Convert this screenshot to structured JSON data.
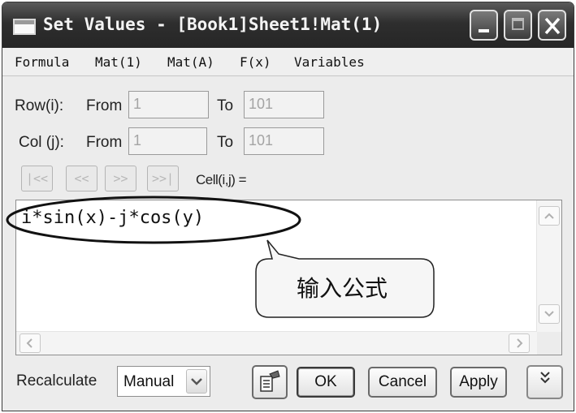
{
  "window": {
    "title": "Set Values - [Book1]Sheet1!Mat(1)"
  },
  "menu": [
    {
      "label": "Formula"
    },
    {
      "label": "Mat(1)"
    },
    {
      "label": "Mat(A)"
    },
    {
      "label": "F(x)"
    },
    {
      "label": "Variables"
    }
  ],
  "range": {
    "row_label": "Row(i):",
    "col_label": "Col (j):",
    "from_label": "From",
    "to_label": "To",
    "row_from": "1",
    "row_to": "101",
    "col_from": "1",
    "col_to": "101"
  },
  "nav": {
    "first": "|<<",
    "prev": "<<",
    "next": ">>",
    "last": ">>|",
    "cell_label": "Cell(i,j) ="
  },
  "editor": {
    "formula": "i*sin(x)-j*cos(y)",
    "annotation": "输入公式"
  },
  "bottom": {
    "recalc_label": "Recalculate",
    "recalc_value": "Manual",
    "ok": "OK",
    "cancel": "Cancel",
    "apply": "Apply",
    "expand": "»"
  },
  "colors": {
    "titlebar": "#2e2e2e",
    "dialog_bg": "#ececec",
    "disabled_text": "#a4a4a4"
  }
}
